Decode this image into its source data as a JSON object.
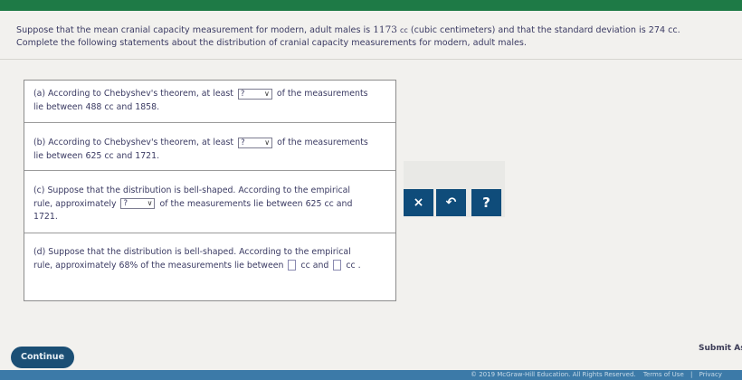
{
  "prompt": {
    "line1_before": "Suppose that the mean cranial capacity measurement for modern, adult males is ",
    "mean": "1173",
    "unit_small": "cc",
    "line1_after": " (cubic centimeters) and that the standard deviation is 274 cc.",
    "line2": "Complete the following statements about the distribution of cranial capacity measurements for modern, adult males."
  },
  "questions": {
    "a": {
      "before": "(a) According to Chebyshev's theorem, at least",
      "select_value": "?",
      "after": "of the measurements",
      "line2": "lie between 488 cc and 1858."
    },
    "b": {
      "before": "(b) According to Chebyshev's theorem, at least",
      "select_value": "?",
      "after": "of the measurements",
      "line2": "lie between 625 cc and 1721."
    },
    "c": {
      "line1": "(c) Suppose that the distribution is bell-shaped. According to the empirical",
      "before": "rule, approximately",
      "select_value": "?",
      "after": "of the measurements lie between 625 cc and",
      "line3": "1721."
    },
    "d": {
      "line1": "(d) Suppose that the distribution is bell-shaped. According to the empirical",
      "before": "rule, approximately 68% of the measurements lie between",
      "mid": "cc and",
      "end": "cc ."
    }
  },
  "tools": {
    "clear_symbol": "×",
    "undo_symbol": "↶",
    "help_symbol": "?"
  },
  "actions": {
    "continue_label": "Continue",
    "submit_label": "Submit As"
  },
  "footer": {
    "copyright": "© 2019 McGraw-Hill Education. All Rights Reserved.",
    "terms": "Terms of Use",
    "separator": "|",
    "privacy": "Privacy"
  }
}
